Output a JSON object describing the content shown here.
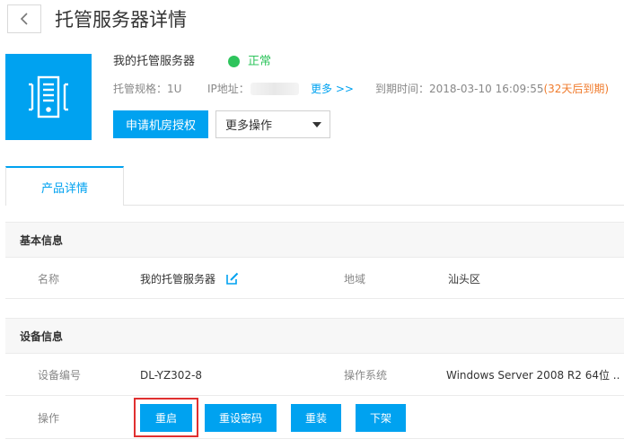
{
  "header": {
    "title": "托管服务器详情",
    "back_icon": "chevron-left-icon"
  },
  "server": {
    "logo_icon": "server-rack-icon",
    "name": "我的托管服务器",
    "status": "正常",
    "status_color": "#2ec45c",
    "spec": "托管规格：1U",
    "ip_label": "IP地址：",
    "more_link": "更多 >>",
    "expire_label": "到期时间：",
    "expire_time": "2018-03-10 16:09:55",
    "expire_warning": "(32天后到期)"
  },
  "actions": {
    "apply_label": "申请机房授权",
    "more_ops_label": "更多操作"
  },
  "tabs": [
    {
      "label": "产品详情",
      "active": true
    }
  ],
  "basic_info": {
    "title": "基本信息",
    "name_label": "名称",
    "name_value": "我的托管服务器",
    "region_label": "地域",
    "region_value": "汕头区"
  },
  "device_info": {
    "title": "设备信息",
    "device_no_label": "设备编号",
    "device_no_value": "DL-YZ302-8",
    "os_label": "操作系统",
    "os_value": "Windows Server 2008 R2 64位 ...",
    "ops_label": "操作",
    "buttons": [
      "重启",
      "重设密码",
      "重装",
      "下架"
    ]
  },
  "colors": {
    "accent": "#00a2f0",
    "warning": "#f07b2c",
    "highlight": "#e03030"
  }
}
